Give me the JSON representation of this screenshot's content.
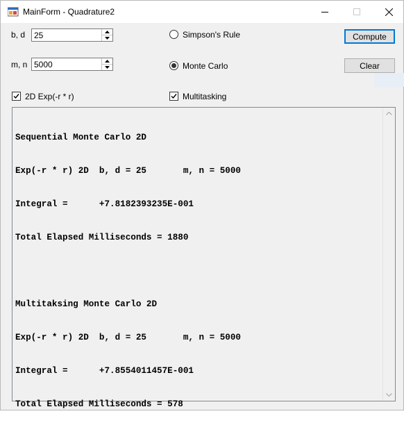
{
  "window": {
    "title": "MainForm - Quadrature2"
  },
  "titlebar": {
    "minimize_glyph": "—",
    "maximize_glyph": "☐",
    "close_glyph": "✕"
  },
  "fields": {
    "bd": {
      "label": "b, d",
      "value": "25"
    },
    "mn": {
      "label": "m, n",
      "value": "5000"
    }
  },
  "radios": {
    "simpson": {
      "label": "Simpson's Rule",
      "checked": false
    },
    "monte_carlo": {
      "label": "Monte Carlo",
      "checked": true
    }
  },
  "checkboxes": {
    "exp2d": {
      "label": "2D Exp(-r * r)",
      "checked": true
    },
    "multitasking": {
      "label": "Multitasking",
      "checked": true
    }
  },
  "buttons": {
    "compute": "Compute",
    "clear": "Clear"
  },
  "output": {
    "lines": [
      "Sequential Monte Carlo 2D",
      "Exp(-r * r) 2D  b, d = 25       m, n = 5000",
      "Integral =      +7.8182393235E-001",
      "Total Elapsed Milliseconds = 1880",
      "",
      "Multitaksing Monte Carlo 2D",
      "Exp(-r * r) 2D  b, d = 25       m, n = 5000",
      "Integral =      +7.8554011457E-001",
      "Total Elapsed Milliseconds = 578"
    ]
  },
  "icons": {
    "app": "app-icon",
    "check": "checkmark-icon",
    "spin_up": "arrow-up-icon",
    "spin_down": "arrow-down-icon"
  }
}
